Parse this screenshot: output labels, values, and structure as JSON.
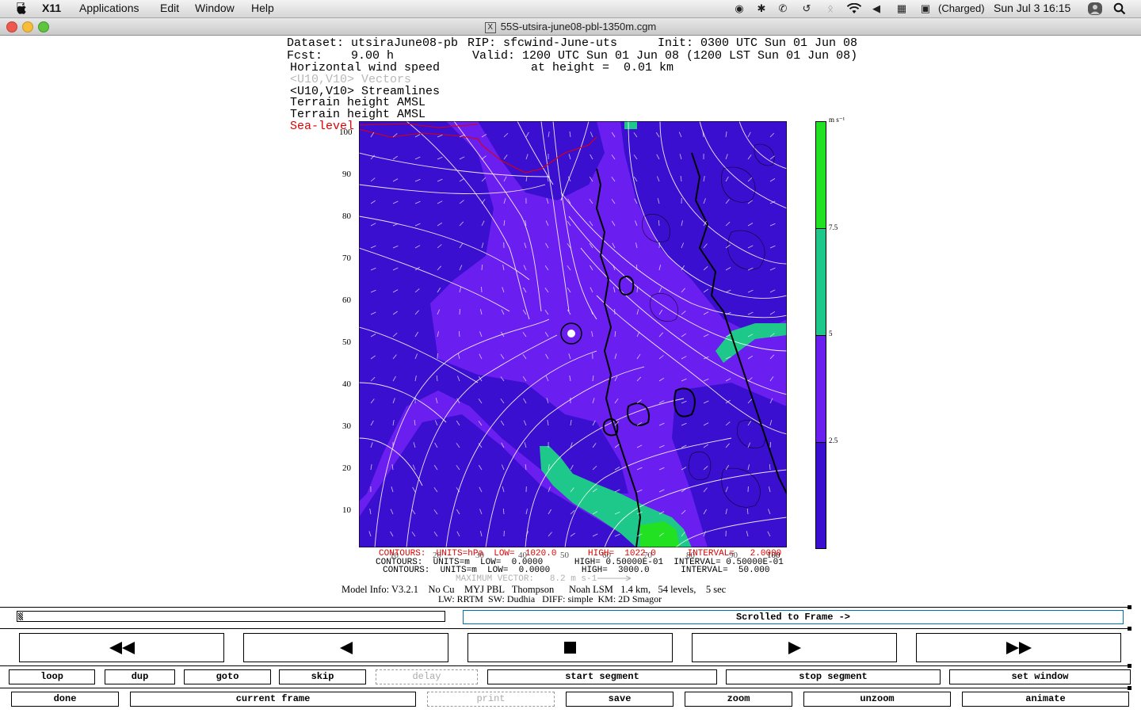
{
  "menubar": {
    "app_name": "X11",
    "menus": [
      "Applications",
      "Edit",
      "Window",
      "Help"
    ],
    "battery_status": "(Charged)",
    "clock": "Sun Jul 3  16:15"
  },
  "window": {
    "title": "55S-utsira-june08-pbl-1350m.cgm"
  },
  "plot": {
    "line1_left": "Dataset: utsiraJune08-pb",
    "line1_mid": "RIP: sfcwind-June-uts",
    "line1_right": "Init: 0300 UTC Sun 01 Jun 08",
    "line2_left": "Fcst:    9.00 h",
    "line2_right": "Valid: 1200 UTC Sun 01 Jun 08 (1200 LST Sun 01 Jun 08)",
    "line3_left": "Horizontal wind speed",
    "line3_right": "at height =  0.01 km",
    "line4": "<U10,V10> Vectors",
    "line5": "<U10,V10> Streamlines",
    "line6": "Terrain height AMSL",
    "line7": "Terrain height AMSL",
    "line8": "Sea-level pressure",
    "y_ticks": [
      "100",
      "90",
      "80",
      "70",
      "60",
      "50",
      "40",
      "30",
      "20",
      "10"
    ],
    "x_ticks": [
      "10",
      "20",
      "30",
      "40",
      "50",
      "60",
      "70",
      "80",
      "90",
      "100"
    ],
    "colorbar_unit": "m s⁻¹",
    "colorbar_labels": [
      "7.5",
      "5",
      "2.5"
    ],
    "contour1": "CONTOURS:  UNITS=hPa  LOW=  1020.0      HIGH=  1022.0      INTERVAL=   2.0000",
    "contour2": "CONTOURS:  UNITS=m  LOW=  0.0000      HIGH= 0.50000E-01  INTERVAL= 0.50000E-01",
    "contour3": "CONTOURS:  UNITS=m  LOW=  0.0000      HIGH=  3000.0      INTERVAL=  50.000",
    "max_vector": "MAXIMUM VECTOR:   8.2 m s-1",
    "model_info": "Model Info: V3.2.1    No Cu    MYJ PBL   Thompson      Noah LSM   1.4 km,   54 levels,    5 sec",
    "model_info2": "LW: RRTM  SW: Dudhia   DIFF: simple  KM: 2D Smagor"
  },
  "colors": {
    "speed_0_2_5": "#3a0fd0",
    "speed_2_5_5": "#6a1ff0",
    "speed_5_7_5": "#1ec88a",
    "speed_7_5_10": "#22e022",
    "slp_contour": "#e00000"
  },
  "controls": {
    "status": "Scrolled to Frame ->",
    "row1": [
      "loop",
      "dup",
      "goto",
      "skip",
      "delay",
      "start segment",
      "stop segment",
      "set window"
    ],
    "row2": [
      "done",
      "current frame",
      "print",
      "save",
      "zoom",
      "unzoom",
      "animate"
    ],
    "transport_icons": [
      "rewind-icon",
      "step-back-icon",
      "stop-icon",
      "play-icon",
      "fast-forward-icon"
    ]
  }
}
